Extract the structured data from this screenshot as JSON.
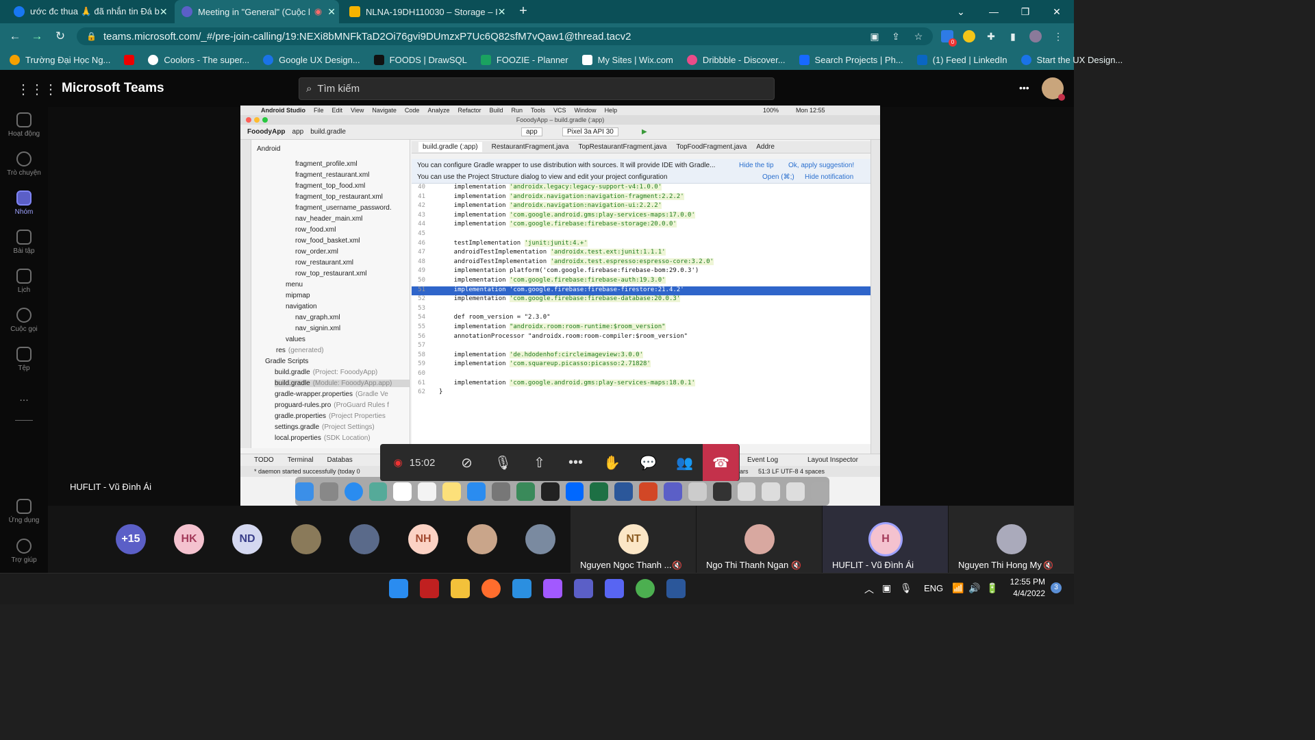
{
  "browser": {
    "tabs": [
      {
        "label": "ước đc thua 🙏 đã nhắn tin Đá b"
      },
      {
        "label": "Meeting in \"General\" (Cuộc l"
      },
      {
        "label": "NLNA-19DH110030 – Storage – I"
      }
    ],
    "new_tab": "+",
    "url": "teams.microsoft.com/_#/pre-join-calling/19:NEXi8bMNFkTaD2Oi76gvi9DUmzxP7Uc6Q82sfM7vQaw1@thread.tacv2",
    "bookmarks": [
      "Trường Đại Học Ng...",
      "Coolors - The super...",
      "Google UX Design...",
      "FOODS | DrawSQL",
      "FOOZIE - Planner",
      "My Sites | Wix.com",
      "Dribbble - Discover...",
      "Search Projects | Ph...",
      "(1) Feed | LinkedIn",
      "Start the UX Design..."
    ],
    "extension_badge": "0"
  },
  "teams": {
    "app_name": "Microsoft Teams",
    "search_placeholder": "Tìm kiếm",
    "more": "•••",
    "rail": [
      {
        "label": "Hoạt động",
        "icon": "bell-icon"
      },
      {
        "label": "Trò chuyện",
        "icon": "chat-icon"
      },
      {
        "label": "Nhóm",
        "icon": "teams-icon"
      },
      {
        "label": "Bài tập",
        "icon": "backpack-icon"
      },
      {
        "label": "Lịch",
        "icon": "calendar-icon"
      },
      {
        "label": "Cuộc gọi",
        "icon": "phone-icon"
      },
      {
        "label": "Tệp",
        "icon": "file-icon"
      }
    ],
    "rail_more": "...",
    "rail_bottom": [
      {
        "label": "Ứng dụng",
        "icon": "apps-icon"
      },
      {
        "label": "Trợ giúp",
        "icon": "help-icon"
      }
    ],
    "presenter_name": "HUFLIT - Vũ Đình Ái",
    "call_time": "15:02",
    "participants": {
      "overflow": "+15",
      "avatars": [
        "HK",
        "ND",
        "",
        "",
        "NH",
        "",
        ""
      ],
      "named_tiles": [
        {
          "initials": "NT",
          "name": "Nguyen Ngoc Thanh ..."
        },
        {
          "initials": "",
          "name": "Ngo Thi Thanh Ngan"
        },
        {
          "initials": "H",
          "name": "HUFLIT - Vũ Đình Ái"
        },
        {
          "initials": "",
          "name": "Nguyen Thi Hong My"
        }
      ]
    }
  },
  "shared_screen": {
    "mac_menu": [
      "Android Studio",
      "File",
      "Edit",
      "View",
      "Navigate",
      "Code",
      "Analyze",
      "Refactor",
      "Build",
      "Run",
      "Tools",
      "VCS",
      "Window",
      "Help"
    ],
    "mac_status": "100%",
    "mac_time": "Mon 12:55",
    "window_title": "FooodyApp – build.gradle (:app)",
    "breadcrumb": [
      "FooodyApp",
      "app",
      "build.gradle"
    ],
    "run_config": "app",
    "device": "Pixel 3a API 30",
    "project_view": "Android",
    "editor_tabs": [
      "build.gradle (:app)",
      "RestaurantFragment.java",
      "TopRestaurantFragment.java",
      "TopFoodFragment.java",
      "Addre"
    ],
    "tip1": "You can configure Gradle wrapper to use distribution with sources. It will provide IDE with Gradle...",
    "tip1_hide": "Hide the tip",
    "tip1_ok": "Ok, apply suggestion!",
    "tip2": "You can use the Project Structure dialog to view and edit your project configuration",
    "tip2_open": "Open (⌘;)",
    "tip2_hide": "Hide notification",
    "tree": [
      {
        "label": "fragment_profile.xml",
        "dim": ""
      },
      {
        "label": "fragment_restaurant.xml",
        "dim": ""
      },
      {
        "label": "fragment_top_food.xml",
        "dim": ""
      },
      {
        "label": "fragment_top_restaurant.xml",
        "dim": ""
      },
      {
        "label": "fragment_username_password.",
        "dim": ""
      },
      {
        "label": "nav_header_main.xml",
        "dim": ""
      },
      {
        "label": "row_food.xml",
        "dim": ""
      },
      {
        "label": "row_food_basket.xml",
        "dim": ""
      },
      {
        "label": "row_order.xml",
        "dim": ""
      },
      {
        "label": "row_restaurant.xml",
        "dim": ""
      },
      {
        "label": "row_top_restaurant.xml",
        "dim": ""
      },
      {
        "label": "menu",
        "dim": ""
      },
      {
        "label": "mipmap",
        "dim": ""
      },
      {
        "label": "navigation",
        "dim": ""
      },
      {
        "label": "nav_graph.xml",
        "dim": ""
      },
      {
        "label": "nav_signin.xml",
        "dim": ""
      },
      {
        "label": "values",
        "dim": ""
      },
      {
        "label": "res",
        "dim": "(generated)"
      },
      {
        "label": "Gradle Scripts",
        "dim": ""
      },
      {
        "label": "build.gradle",
        "dim": "(Project: FooodyApp)"
      },
      {
        "label": "build.gradle",
        "dim": "(Module: FooodyApp.app)"
      },
      {
        "label": "gradle-wrapper.properties",
        "dim": "(Gradle Ve"
      },
      {
        "label": "proguard-rules.pro",
        "dim": "(ProGuard Rules f"
      },
      {
        "label": "gradle.properties",
        "dim": "(Project Properties"
      },
      {
        "label": "settings.gradle",
        "dim": "(Project Settings)"
      },
      {
        "label": "local.properties",
        "dim": "(SDK Location)"
      }
    ],
    "code": [
      {
        "n": "40",
        "pre": "    implementation ",
        "str": "'androidx.legacy:legacy-support-v4:1.0.0'",
        "post": ""
      },
      {
        "n": "41",
        "pre": "    implementation ",
        "str": "'androidx.navigation:navigation-fragment:2.2.2'",
        "post": ""
      },
      {
        "n": "42",
        "pre": "    implementation ",
        "str": "'androidx.navigation:navigation-ui:2.2.2'",
        "post": ""
      },
      {
        "n": "43",
        "pre": "    implementation ",
        "str": "'com.google.android.gms:play-services-maps:17.0.0'",
        "post": ""
      },
      {
        "n": "44",
        "pre": "    implementation ",
        "str": "'com.google.firebase:firebase-storage:20.0.0'",
        "post": ""
      },
      {
        "n": "45",
        "pre": "",
        "str": "",
        "post": ""
      },
      {
        "n": "46",
        "pre": "    testImplementation ",
        "str": "'junit:junit:4.+'",
        "post": ""
      },
      {
        "n": "47",
        "pre": "    androidTestImplementation ",
        "str": "'androidx.test.ext:junit:1.1.1'",
        "post": ""
      },
      {
        "n": "48",
        "pre": "    androidTestImplementation ",
        "str": "'androidx.test.espresso:espresso-core:3.2.0'",
        "post": ""
      },
      {
        "n": "49",
        "pre": "    implementation platform('com.google.firebase:firebase-bom:29.0.3')",
        "str": "",
        "post": ""
      },
      {
        "n": "50",
        "pre": "    implementation ",
        "str": "'com.google.firebase:firebase-auth:19.3.0'",
        "post": ""
      },
      {
        "n": "51",
        "pre": "    implementation ",
        "str": "'com.google.firebase:firebase-firestore:21.4.2'",
        "post": ""
      },
      {
        "n": "52",
        "pre": "    implementation ",
        "str": "'com.google.firebase:firebase-database:20.0.3'",
        "post": ""
      },
      {
        "n": "53",
        "pre": "",
        "str": "",
        "post": ""
      },
      {
        "n": "54",
        "pre": "    def room_version = \"2.3.0\"",
        "str": "",
        "post": ""
      },
      {
        "n": "55",
        "pre": "    implementation ",
        "str": "\"androidx.room:room-runtime:$room_version\"",
        "post": ""
      },
      {
        "n": "56",
        "pre": "    annotationProcessor \"androidx.room:room-compiler:$room_version\"",
        "str": "",
        "post": ""
      },
      {
        "n": "57",
        "pre": "",
        "str": "",
        "post": ""
      },
      {
        "n": "58",
        "pre": "    implementation ",
        "str": "'de.hdodenhof:circleimageview:3.0.0'",
        "post": ""
      },
      {
        "n": "59",
        "pre": "    implementation ",
        "str": "'com.squareup.picasso:picasso:2.71828'",
        "post": ""
      },
      {
        "n": "60",
        "pre": "",
        "str": "",
        "post": ""
      },
      {
        "n": "61",
        "pre": "    implementation ",
        "str": "'com.google.android.gms:play-services-maps:18.0.1'",
        "post": ""
      },
      {
        "n": "62",
        "pre": "}",
        "str": "",
        "post": ""
      }
    ],
    "selected_line": "51",
    "bottom_tabs": [
      "TODO",
      "Terminal",
      "Databas"
    ],
    "right_tabs": [
      "Event Log",
      "Layout Inspector"
    ],
    "status_msg": "* daemon started successfully (today 0",
    "status_right": "51:3  LF  UTF-8  4 spaces",
    "status_ars": "ars"
  },
  "taskbar": {
    "lang": "ENG",
    "time": "12:55 PM",
    "date": "4/4/2022",
    "notif": "3"
  }
}
